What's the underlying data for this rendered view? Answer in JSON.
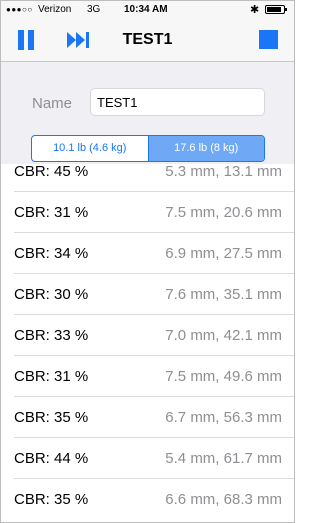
{
  "status_bar": {
    "carrier": "Verizon",
    "network": "3G",
    "time": "10:34 AM",
    "signal_icon": "signal-dots-icon",
    "bluetooth_icon": "bluetooth-icon",
    "battery_icon": "battery-icon"
  },
  "nav": {
    "title": "TEST1",
    "left_icons": [
      "pause-icon",
      "skip-forward-icon"
    ],
    "right_icon": "stop-icon"
  },
  "form": {
    "name_label": "Name",
    "name_value": "TEST1",
    "weight_options": [
      "10.1 lb (4.6 kg)",
      "17.6 lb (8 kg)"
    ],
    "selected_weight": "17.6 lb (8 kg)"
  },
  "results": [
    {
      "cbr": "CBR: 45 %",
      "dims": "5.3 mm, 13.1 mm"
    },
    {
      "cbr": "CBR: 31 %",
      "dims": "7.5 mm, 20.6 mm"
    },
    {
      "cbr": "CBR: 34 %",
      "dims": "6.9 mm, 27.5 mm"
    },
    {
      "cbr": "CBR: 30 %",
      "dims": "7.6 mm, 35.1 mm"
    },
    {
      "cbr": "CBR: 33 %",
      "dims": "7.0 mm, 42.1 mm"
    },
    {
      "cbr": "CBR: 31 %",
      "dims": "7.5 mm, 49.6 mm"
    },
    {
      "cbr": "CBR: 35 %",
      "dims": "6.7 mm, 56.3 mm"
    },
    {
      "cbr": "CBR: 44 %",
      "dims": "5.4 mm, 61.7 mm"
    },
    {
      "cbr": "CBR: 35 %",
      "dims": "6.6 mm, 68.3 mm"
    }
  ],
  "colors": {
    "accent": "#1a76f5",
    "segment_selected": "#6fa9f6",
    "form_background": "#efeff4",
    "secondary_text": "#8e8e93"
  }
}
